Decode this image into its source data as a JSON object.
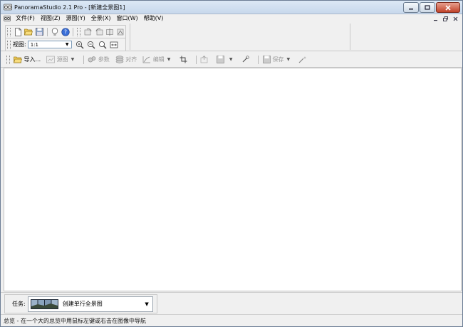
{
  "window": {
    "title": "PanoramaStudio 2.1 Pro - [新建全景图1]"
  },
  "menu": {
    "items": [
      {
        "label": "文件(F)"
      },
      {
        "label": "视图(Z)"
      },
      {
        "label": "源图(Y)"
      },
      {
        "label": "全景(X)"
      },
      {
        "label": "窗口(W)"
      },
      {
        "label": "帮助(V)"
      }
    ]
  },
  "toolbar_main": {
    "view_label": "视图:",
    "view_value": "1:1"
  },
  "toolbar_secondary": {
    "import_label": "导入...",
    "source_label": "源图",
    "params_label": "参数",
    "align_label": "对齐",
    "edit_label": "编辑",
    "save_label": "保存"
  },
  "task": {
    "label": "任务:",
    "selected": "创建单行全景图"
  },
  "status": {
    "text": "总览 - 在一个大的总览中用鼠标左键或右击在图像中导航"
  },
  "colors": {
    "canvas": "#ffffff",
    "chrome": "#f0f0f0",
    "titlebar": "#c7d8ec",
    "close_button": "#c2432a"
  }
}
